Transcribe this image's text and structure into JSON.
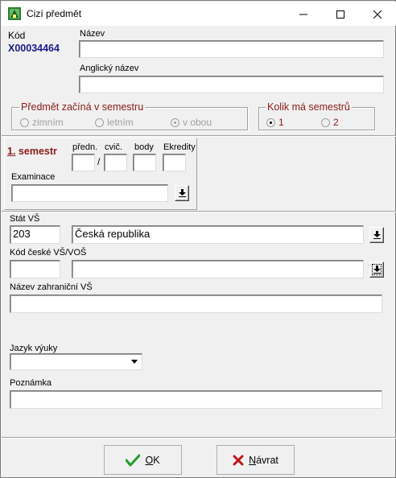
{
  "window": {
    "title": "Cizí předmět"
  },
  "header": {
    "kod_label": "Kód",
    "kod_value": "X00034464",
    "nazev_label": "Název",
    "nazev_value": "",
    "anglicky_label": "Anglický název",
    "anglicky_value": ""
  },
  "start_semester": {
    "title": "Předmět začíná v semestru",
    "options": [
      "zimním",
      "letním",
      "v obou"
    ],
    "selected": "v obou"
  },
  "semester_count": {
    "title": "Kolik má semestrů",
    "options": [
      "1",
      "2"
    ],
    "selected": "1"
  },
  "semester_panel": {
    "title": "semestr",
    "title_number": "1.",
    "col_prednasky": "předn.",
    "col_cviceni": "cvič.",
    "col_body": "body",
    "col_ekredity": "Ekredity",
    "slash": "/",
    "examinace_label": "Examinace",
    "examinace_value": ""
  },
  "school": {
    "stat_label": "Stát VŠ",
    "stat_code": "203",
    "stat_name": "Česká republika",
    "kod_vs_label": "Kód české VŠ/VOŠ",
    "kod_vs_value": "",
    "kod_vs_name": "",
    "nazev_zahr_label": "Název zahraniční VŠ",
    "nazev_zahr_value": ""
  },
  "language": {
    "label": "Jazyk výuky",
    "value": ""
  },
  "note": {
    "label": "Poznámka",
    "value": ""
  },
  "buttons": {
    "ok_label": "OK",
    "ok_mnemonic": "O",
    "ok_rest": "K",
    "navrat_label": "Návrat",
    "navrat_mnemonic": "N",
    "navrat_rest": "ávrat"
  },
  "colors": {
    "kod_value": "#1a1a8c",
    "group_title": "#8b1a1a",
    "ok_check": "#1e9e2a",
    "cancel_x": "#c0161a"
  }
}
